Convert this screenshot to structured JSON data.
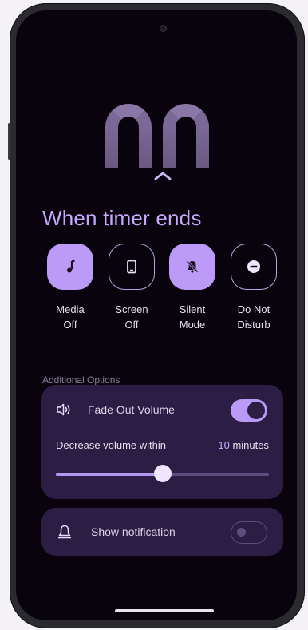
{
  "timer": {
    "digits": "00"
  },
  "when_timer_ends": {
    "title": "When timer ends",
    "actions": [
      {
        "id": "media-off",
        "line1": "Media",
        "line2": "Off",
        "icon": "music-note-icon",
        "selected": true
      },
      {
        "id": "screen-off",
        "line1": "Screen",
        "line2": "Off",
        "icon": "phone-icon",
        "selected": false
      },
      {
        "id": "silent-mode",
        "line1": "Silent",
        "line2": "Mode",
        "icon": "bell-off-icon",
        "selected": true
      },
      {
        "id": "do-not-disturb",
        "line1": "Do Not",
        "line2": "Disturb",
        "icon": "minus-circle-icon",
        "selected": false
      }
    ]
  },
  "additional_options": {
    "header": "Additional Options",
    "fade_out": {
      "label": "Fade Out Volume",
      "enabled": true,
      "decrease_label": "Decrease volume within",
      "value": "10",
      "unit": "minutes",
      "slider_fraction": 0.5
    },
    "notification": {
      "label": "Show notification",
      "enabled": false
    }
  },
  "colors": {
    "accent": "#bb9af8",
    "card": "#2b1d43",
    "title": "#c6a9ff",
    "background": "#08030c"
  }
}
